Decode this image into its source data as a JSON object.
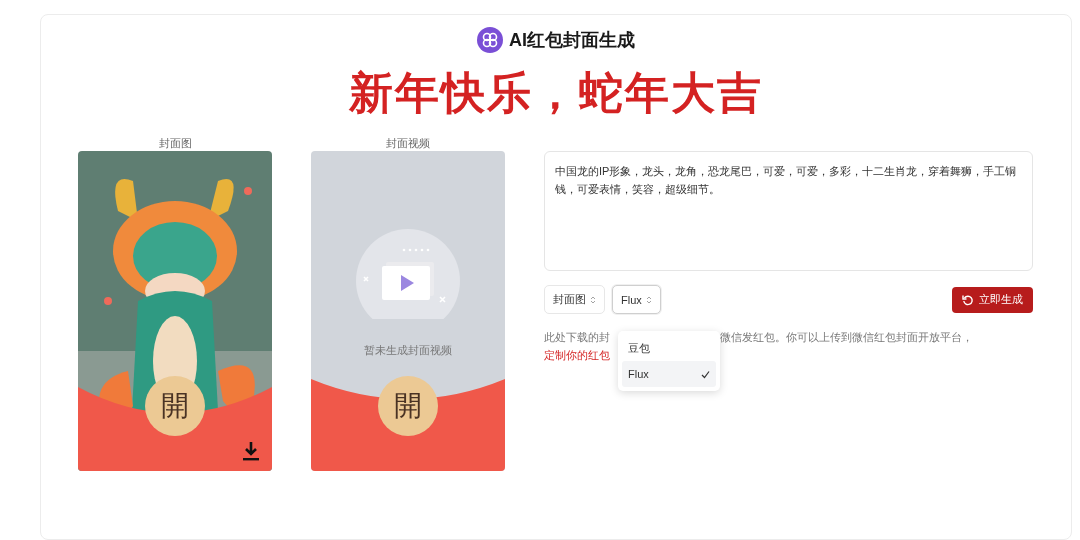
{
  "app": {
    "title": "AI红包封面生成"
  },
  "headline": "新年快乐，蛇年大吉",
  "previews": [
    {
      "label": "封面图",
      "open_text": "開",
      "downloadable": true
    },
    {
      "kind": "video",
      "label": "封面视频",
      "empty_text": "暂未生成封面视频",
      "open_text": "開"
    }
  ],
  "prompt": {
    "value": "中国龙的IP形象，龙头，龙角，恐龙尾巴，可爱，可爱，多彩，十二生肖龙，穿着舞狮，手工铜钱，可爱表情，笑容，超级细节。"
  },
  "selects": [
    {
      "value": "封面图",
      "expanded": false
    },
    {
      "value": "Flux",
      "expanded": true,
      "options": [
        {
          "label": "豆包",
          "selected": false
        },
        {
          "label": "Flux",
          "selected": true
        }
      ]
    }
  ],
  "generate_button": {
    "label": "立即生成"
  },
  "notice": {
    "line_start": "此处下载的封",
    "line_rest": "微信发红包。你可以上传到微信红包封面开放平台，",
    "link": "定制你的红包"
  }
}
